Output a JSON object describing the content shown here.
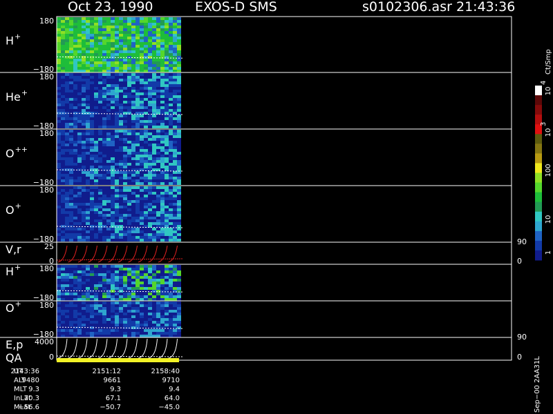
{
  "header": {
    "date": "Oct 23, 1990",
    "instrument": "EXOS-D SMS",
    "file": "s0102306.asr",
    "time": "21:43:36"
  },
  "colorbar": {
    "title": "Ct/Smp",
    "labels": [
      "1",
      "10",
      "100",
      "10",
      "10"
    ],
    "sups": [
      "3",
      "4"
    ],
    "colors": [
      "#101c8c",
      "#123aa8",
      "#1f63c4",
      "#2ea6cf",
      "#30c7c2",
      "#229a54",
      "#1ebd3a",
      "#54d62c",
      "#8fdf24",
      "#f0e81c",
      "#b89a12",
      "#857612",
      "#5d5b0e",
      "#e01010",
      "#b40e0e",
      "#850b0b",
      "#5c0808",
      "#ffffff"
    ]
  },
  "panels": [
    {
      "label": "H",
      "sup": "+",
      "ymax": "180",
      "ymin": "−180"
    },
    {
      "label": "He",
      "sup": "+",
      "ymax": "180",
      "ymin": "−180"
    },
    {
      "label": "O",
      "sup": "++",
      "ymax": "180",
      "ymin": "−180"
    },
    {
      "label": "O",
      "sup": "+",
      "ymax": "180",
      "ymin": "−180"
    },
    {
      "label": "V,r",
      "sup": "",
      "ymax": "25",
      "ymin": "0",
      "rmax": "90",
      "rmin": "0"
    },
    {
      "label": "H",
      "sup": "+",
      "ymax": "180",
      "ymin": "−180"
    },
    {
      "label": "O",
      "sup": "+",
      "ymax": "180",
      "ymin": "−180"
    },
    {
      "label": "E,p",
      "sup": "",
      "ymax": "4000",
      "ymin": "0",
      "rmax": "90",
      "rmin": "0"
    }
  ],
  "qa_label": "QA",
  "side_note": "Sep−00 2AA31L",
  "footer": {
    "rows": [
      {
        "name": "UT",
        "values": [
          "2143:36",
          "2151:12",
          "2158:40"
        ]
      },
      {
        "name": "ALT",
        "values": [
          "9480",
          "9661",
          "9710"
        ]
      },
      {
        "name": "MLT",
        "values": [
          "9.3",
          "9.3",
          "9.4"
        ]
      },
      {
        "name": "InLat",
        "values": [
          "70.3",
          "67.1",
          "64.0"
        ]
      },
      {
        "name": "MLat",
        "values": [
          "−56.6",
          "−50.7",
          "−45.0"
        ]
      }
    ]
  },
  "chart_data": {
    "type": "heatmap",
    "title": "Oct 23, 1990   EXOS-D SMS",
    "x_ticks": [
      "2143:36",
      "2151:12",
      "2158:40"
    ],
    "data_coverage_end": "2158:40",
    "z_unit": "Ct/Smp",
    "z_scale": "log",
    "z_range": [
      1,
      10000
    ],
    "series": [
      {
        "name": "H+",
        "ylim": [
          -180,
          180
        ],
        "dominant_level": "10-100"
      },
      {
        "name": "He+",
        "ylim": [
          -180,
          180
        ],
        "dominant_level": "1-10"
      },
      {
        "name": "O++",
        "ylim": [
          -180,
          180
        ],
        "dominant_level": "1-10"
      },
      {
        "name": "O+",
        "ylim": [
          -180,
          180
        ],
        "dominant_level": "1-10"
      },
      {
        "name": "V,r",
        "ylim": [
          0,
          25
        ],
        "rlim": [
          0,
          90
        ]
      },
      {
        "name": "H+",
        "ylim": [
          -180,
          180
        ],
        "dominant_level": "1-10"
      },
      {
        "name": "O+",
        "ylim": [
          -180,
          180
        ],
        "dominant_level": "1-10"
      },
      {
        "name": "E,p",
        "ylim": [
          0,
          4000
        ],
        "rlim": [
          0,
          90
        ]
      }
    ]
  }
}
